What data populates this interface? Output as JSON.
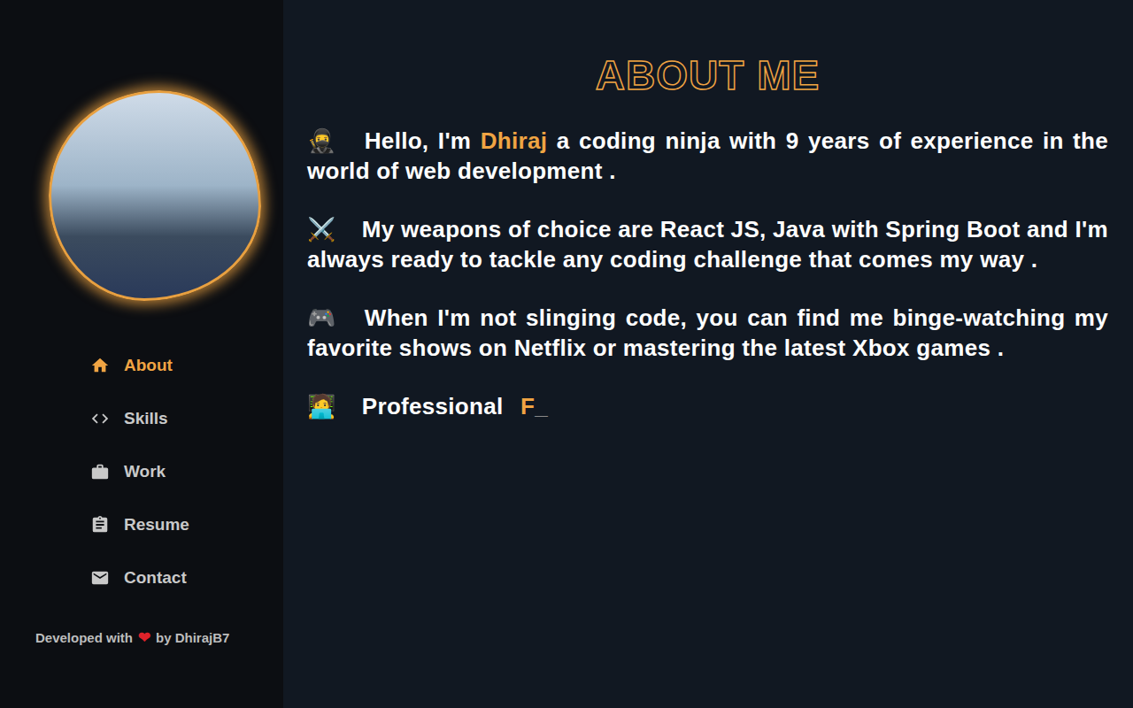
{
  "sidebar": {
    "nav": [
      {
        "label": "About",
        "selected": true
      },
      {
        "label": "Skills",
        "selected": false
      },
      {
        "label": "Work",
        "selected": false
      },
      {
        "label": "Resume",
        "selected": false
      },
      {
        "label": "Contact",
        "selected": false
      }
    ],
    "footer": {
      "before": "Developed with",
      "heart": "❤",
      "after": "by DhirajB7"
    }
  },
  "main": {
    "title": "ABOUT ME",
    "paragraphs": [
      {
        "icon": "🥷",
        "parts": [
          {
            "text": "Hello, I'm ",
            "highlight": false
          },
          {
            "text": "Dhiraj",
            "highlight": true
          },
          {
            "text": " a coding ninja with 9 years of experience in the world of web development .",
            "highlight": false
          }
        ]
      },
      {
        "icon": "⚔️",
        "parts": [
          {
            "text": "My weapons of choice are React JS, Java with Spring Boot and I'm always ready to tackle any coding challenge that comes my way .",
            "highlight": false
          }
        ]
      },
      {
        "icon": "🎮",
        "parts": [
          {
            "text": "When I'm not slinging code, you can find me binge-watching my favorite shows on Netflix or mastering the latest Xbox games .",
            "highlight": false
          }
        ]
      }
    ],
    "typewriter": {
      "icon": "🧑‍💻",
      "prefix": "Professional",
      "typed": "F",
      "cursor": "_"
    }
  }
}
